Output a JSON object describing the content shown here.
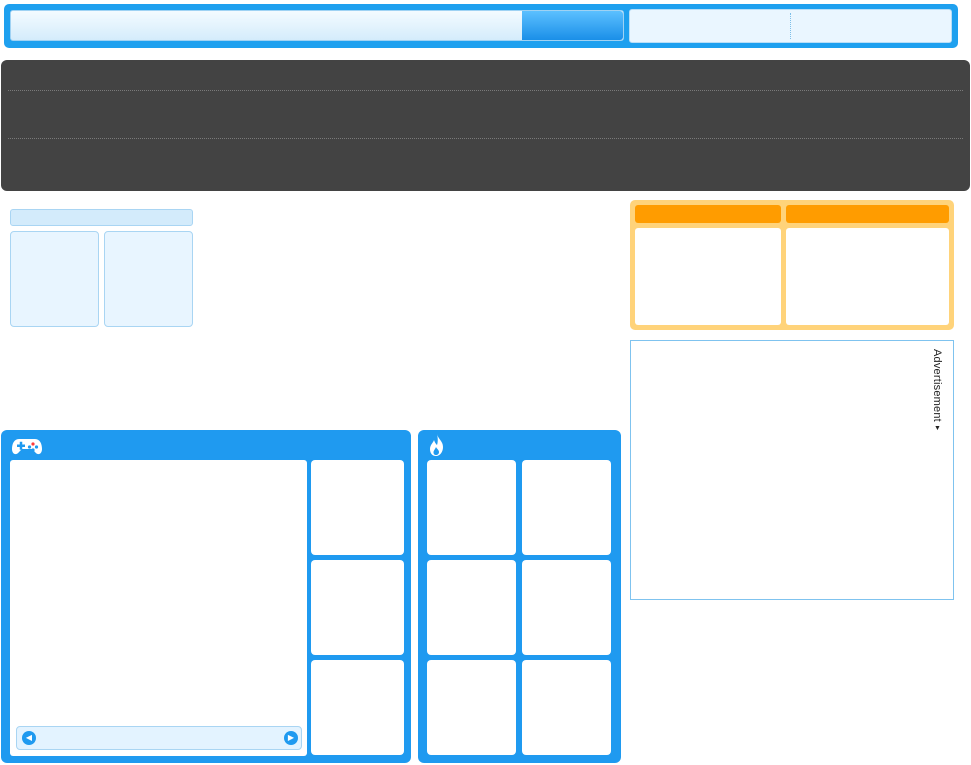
{
  "search": {
    "placeholder": ""
  },
  "advertisement": {
    "label": "Advertisement",
    "arrow": "▼"
  },
  "icons": {
    "games": "gamepad-icon",
    "hot": "flame-icon",
    "pager_prev": "chevron-left-icon",
    "pager_next": "chevron-right-icon"
  },
  "pager": {
    "prev_glyph": "◀",
    "next_glyph": "▶"
  },
  "colors": {
    "primary_blue": "#1f9af0",
    "dark_nav": "#434343",
    "orange": "#ff9c00",
    "orange_light": "#ffd37a",
    "light_blue": "#e8f5ff"
  }
}
